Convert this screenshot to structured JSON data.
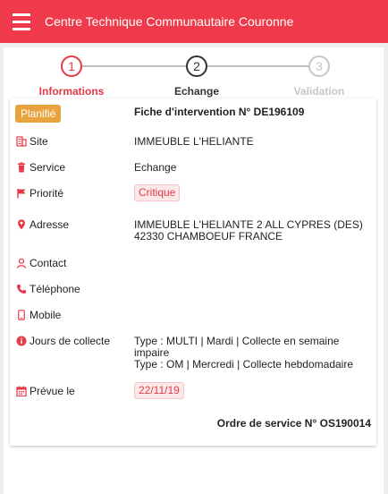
{
  "app": {
    "title": "Centre Technique Communautaire Couronne"
  },
  "stepper": {
    "steps": [
      {
        "number": "1",
        "label": "Informations",
        "state": "active"
      },
      {
        "number": "2",
        "label": "Echange",
        "state": "current"
      },
      {
        "number": "3",
        "label": "Validation",
        "state": "disabled"
      }
    ]
  },
  "card": {
    "status": "Planifié",
    "title": "Fiche d'intervention N° DE196109",
    "fields": {
      "site": {
        "label": "Site",
        "value": "IMMEUBLE L'HELIANTE"
      },
      "service": {
        "label": "Service",
        "value": "Echange"
      },
      "priorite": {
        "label": "Priorité",
        "value": "Critique"
      },
      "adresse": {
        "label": "Adresse",
        "line1": "IMMEUBLE L'HELIANTE 2 ALL CYPRES (DES)",
        "line2": "42330 CHAMBOEUF FRANCE"
      },
      "contact": {
        "label": "Contact",
        "value": ""
      },
      "telephone": {
        "label": "Téléphone",
        "value": ""
      },
      "mobile": {
        "label": "Mobile",
        "value": ""
      },
      "jours": {
        "label": "Jours de collecte",
        "line1": "Type : MULTI | Mardi | Collecte en semaine impaire",
        "line2": "Type : OM | Mercredi | Collecte hebdomadaire"
      },
      "prevue": {
        "label": "Prévue le",
        "value": "22/11/19"
      }
    },
    "order_ref": "Ordre de service N° OS190014"
  },
  "colors": {
    "primary": "#ee3a4a",
    "status_badge": "#e8a33d",
    "chip_bg": "#fbe9ea"
  },
  "icons": {
    "site": "building-icon",
    "service": "trash-icon",
    "priorite": "flag-icon",
    "adresse": "map-pin-icon",
    "contact": "user-icon",
    "telephone": "phone-icon",
    "mobile": "mobile-icon",
    "jours": "info-icon",
    "prevue": "calendar-icon"
  }
}
